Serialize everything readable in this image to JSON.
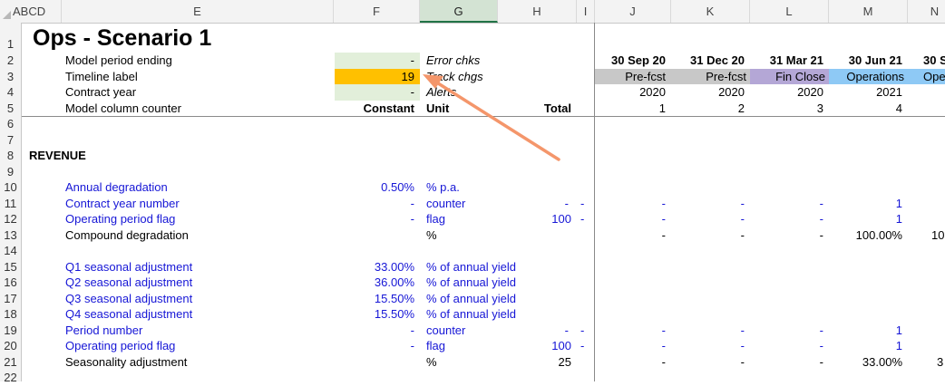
{
  "columns": {
    "abcd": "ABCD",
    "E": "E",
    "F": "F",
    "G": "G",
    "H": "H",
    "I": "I",
    "J": "J",
    "K": "K",
    "L": "L",
    "M": "M",
    "N": "N"
  },
  "rows": {
    "r1": "1",
    "r2": "2",
    "r3": "3",
    "r4": "4",
    "r5": "5",
    "r6": "6",
    "r7": "7",
    "r8": "8",
    "r9": "9",
    "r10": "10",
    "r11": "11",
    "r12": "12",
    "r13": "13",
    "r14": "14",
    "r15": "15",
    "r16": "16",
    "r17": "17",
    "r18": "18",
    "r19": "19",
    "r20": "20",
    "r21": "21",
    "r22": "22"
  },
  "title": "Ops - Scenario 1",
  "header_rows": {
    "period_ending": {
      "label": "Model period ending",
      "f": "-",
      "g": "Error chks"
    },
    "timeline": {
      "label": "Timeline label",
      "f": "19",
      "g": "Track chgs"
    },
    "contract_year": {
      "label": "Contract year",
      "f": "-",
      "g": "Alerts"
    },
    "counter": {
      "label": "Model column counter",
      "f": "Constant",
      "g": "Unit",
      "h": "Total"
    }
  },
  "timeline": {
    "dates": [
      "30 Sep 20",
      "31 Dec 20",
      "31 Mar 21",
      "30 Jun 21",
      "30 S"
    ],
    "labels": [
      "Pre-fcst",
      "Pre-fcst",
      "Fin Close",
      "Operations",
      "Ope"
    ],
    "years": [
      "2020",
      "2020",
      "2020",
      "2021",
      ""
    ],
    "counters": [
      "1",
      "2",
      "3",
      "4",
      ""
    ]
  },
  "section": "REVENUE",
  "data_rows": [
    {
      "row": "r10",
      "label": "Annual degradation",
      "blue": true,
      "f": "0.50%",
      "g": "% p.a.",
      "h": "",
      "i": "",
      "vals": [
        "",
        "",
        "",
        "",
        ""
      ]
    },
    {
      "row": "r11",
      "label": "Contract year number",
      "blue": true,
      "f": "-",
      "g": "counter",
      "h": "-",
      "i": "-",
      "vals": [
        "-",
        "-",
        "-",
        "1",
        ""
      ]
    },
    {
      "row": "r12",
      "label": "Operating period flag",
      "blue": true,
      "f": "-",
      "g": "flag",
      "h": "100",
      "i": "-",
      "vals": [
        "-",
        "-",
        "-",
        "1",
        ""
      ]
    },
    {
      "row": "r13",
      "label": "Compound degradation",
      "blue": false,
      "f": "",
      "g": "%",
      "h": "",
      "i": "",
      "vals": [
        "-",
        "-",
        "-",
        "100.00%",
        "10"
      ]
    },
    {
      "row": "r15",
      "label": "Q1 seasonal adjustment",
      "blue": true,
      "f": "33.00%",
      "g": "% of annual yield",
      "h": "",
      "i": "",
      "vals": [
        "",
        "",
        "",
        "",
        ""
      ]
    },
    {
      "row": "r16",
      "label": "Q2 seasonal adjustment",
      "blue": true,
      "f": "36.00%",
      "g": "% of annual yield",
      "h": "",
      "i": "",
      "vals": [
        "",
        "",
        "",
        "",
        ""
      ]
    },
    {
      "row": "r17",
      "label": "Q3 seasonal adjustment",
      "blue": true,
      "f": "15.50%",
      "g": "% of annual yield",
      "h": "",
      "i": "",
      "vals": [
        "",
        "",
        "",
        "",
        ""
      ]
    },
    {
      "row": "r18",
      "label": "Q4 seasonal adjustment",
      "blue": true,
      "f": "15.50%",
      "g": "% of annual yield",
      "h": "",
      "i": "",
      "vals": [
        "",
        "",
        "",
        "",
        ""
      ]
    },
    {
      "row": "r19",
      "label": "Period number",
      "blue": true,
      "f": "-",
      "g": "counter",
      "h": "-",
      "i": "-",
      "vals": [
        "-",
        "-",
        "-",
        "1",
        ""
      ]
    },
    {
      "row": "r20",
      "label": "Operating period flag",
      "blue": true,
      "f": "-",
      "g": "flag",
      "h": "100",
      "i": "-",
      "vals": [
        "-",
        "-",
        "-",
        "1",
        ""
      ]
    },
    {
      "row": "r21",
      "label": "Seasonality adjustment",
      "blue": false,
      "f": "",
      "g": "%",
      "h": "25",
      "i": "",
      "vals": [
        "-",
        "-",
        "-",
        "33.00%",
        "3"
      ]
    }
  ],
  "colors": {
    "input_blue": "#1616d6",
    "input_green": "#e2efda",
    "highlight_orange": "#ffc000",
    "prefcst_grey": "#c8c8c8",
    "finclose_purple": "#b4a7d6",
    "operations_blue": "#8ec9f5",
    "arrow": "#f4966b"
  },
  "annotation": {
    "type": "arrow",
    "icon": "arrow-icon"
  }
}
